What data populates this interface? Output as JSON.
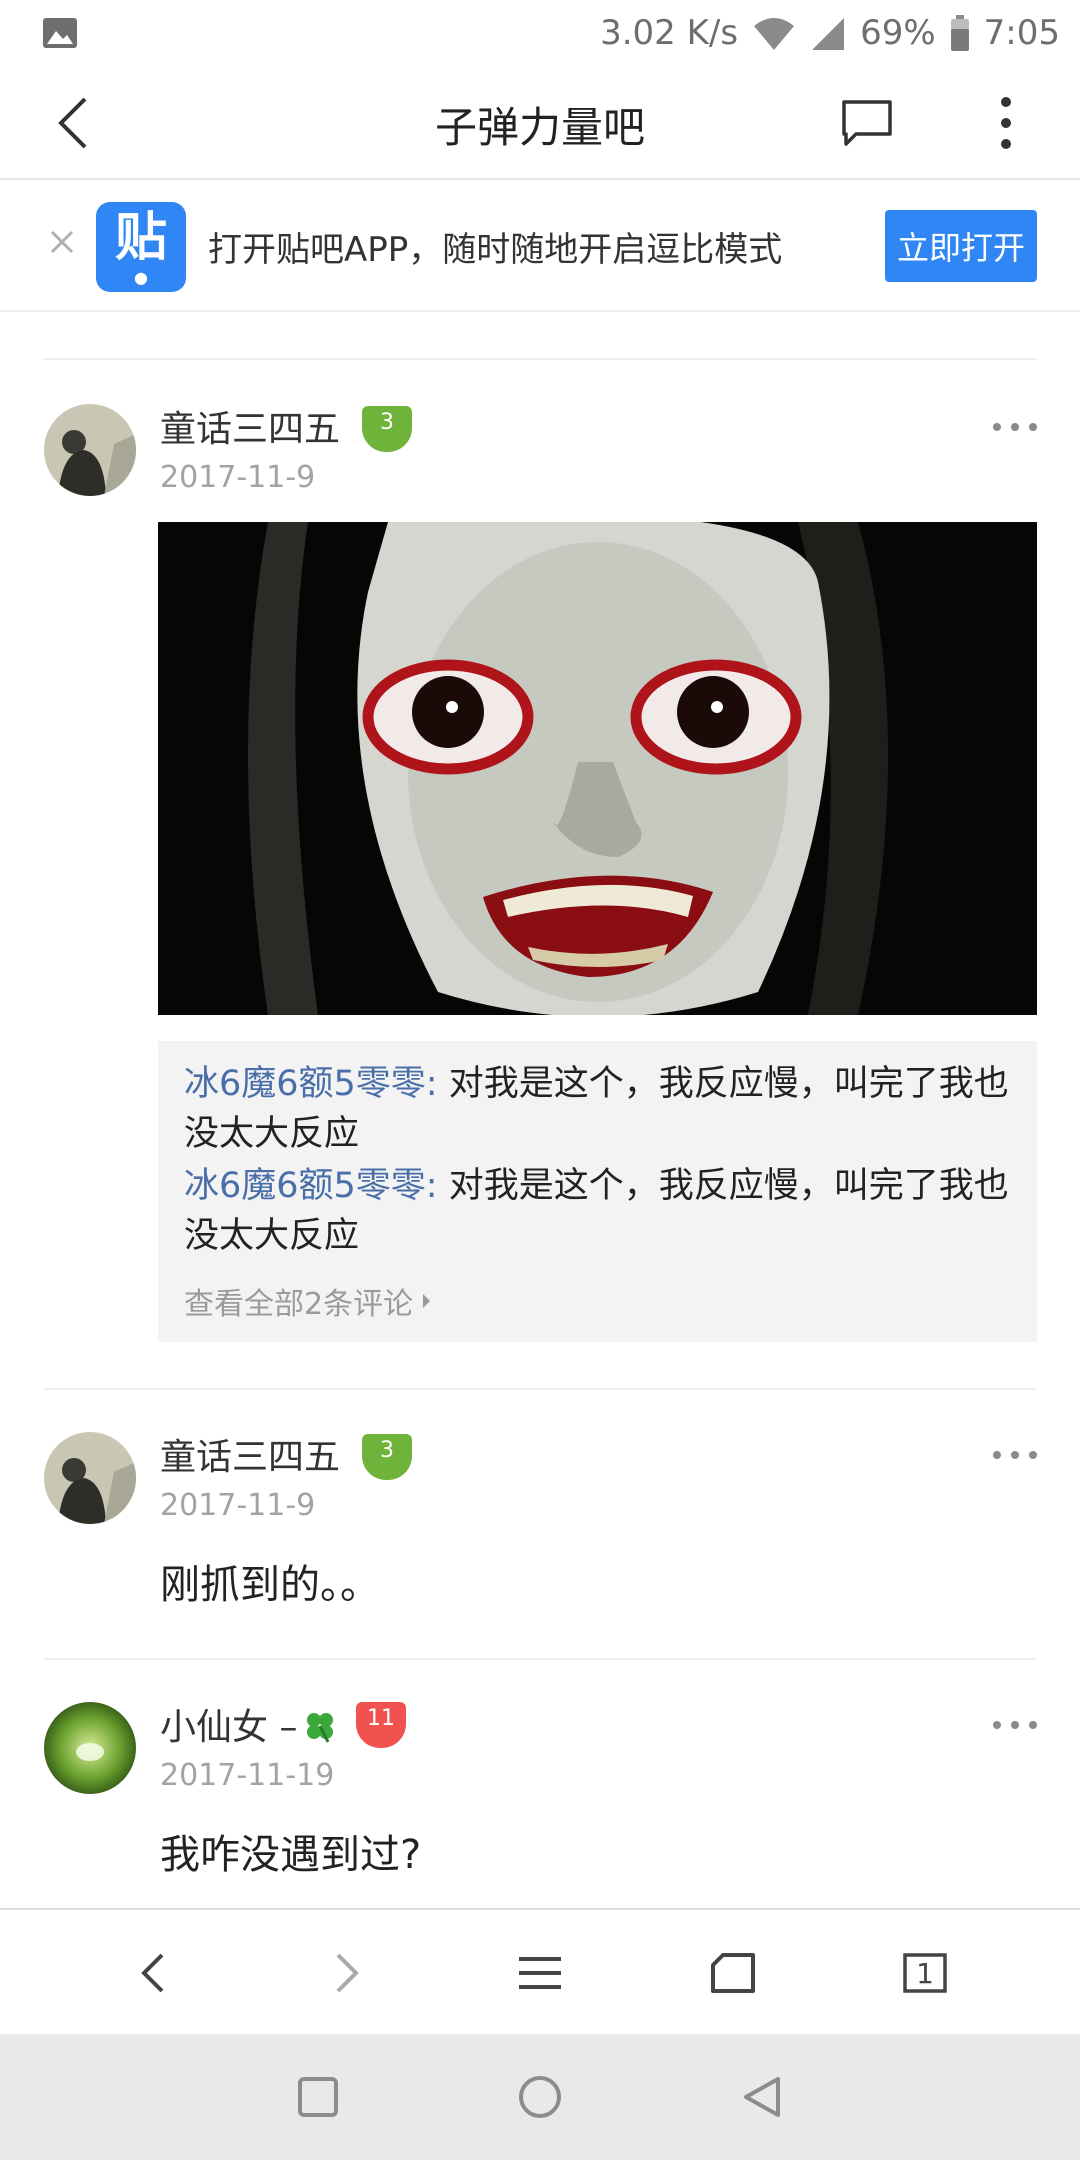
{
  "status_bar": {
    "speed": "3.02 K/s",
    "battery": "69%",
    "time": "7:05",
    "icons": [
      "gallery-icon",
      "wifi-icon",
      "signal-icon",
      "battery-icon"
    ]
  },
  "header": {
    "title": "子弹力量吧",
    "icons": [
      "back-arrow-icon",
      "comment-icon",
      "more-vertical-icon"
    ]
  },
  "banner": {
    "logo_text": "贴",
    "text": "打开贴吧APP，随时随地开启逗比模式",
    "button": "立即打开",
    "icons": [
      "close-icon",
      "tieba-logo-icon"
    ]
  },
  "posts": [
    {
      "user": "童话三四五",
      "level": "3",
      "date": "2017-11-9",
      "image": "horror-face-photo",
      "comments": [
        {
          "user": "冰6魔6额5零零:",
          "text": " 对我是这个，我反应慢，叫完了我也没太大反应"
        },
        {
          "user": "冰6魔6额5零零:",
          "text": " 对我是这个，我反应慢，叫完了我也没太大反应"
        }
      ],
      "view_all": "查看全部2条评论"
    },
    {
      "user": "童话三四五",
      "level": "3",
      "date": "2017-11-9",
      "content": "刚抓到的。。"
    },
    {
      "user": "小仙女 –",
      "level": "11",
      "date": "2017-11-19",
      "content": "我咋没遇到过?"
    }
  ],
  "browser_bar": {
    "tab_count": "1",
    "icons": [
      "back-icon",
      "forward-icon",
      "menu-icon",
      "home-icon",
      "tabs-icon"
    ]
  },
  "nav_bar": {
    "icons": [
      "recent-apps-icon",
      "home-circle-icon",
      "back-triangle-icon"
    ]
  },
  "colors": {
    "accent": "#3186f5",
    "level_green": "#6fb33a",
    "level_red": "#f0524f",
    "link": "#4a6ea8"
  }
}
